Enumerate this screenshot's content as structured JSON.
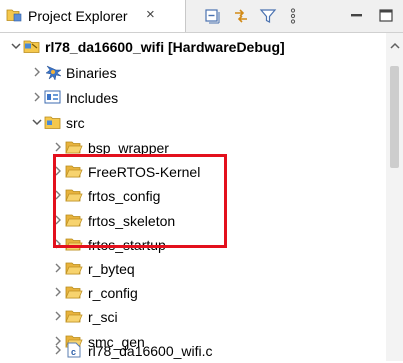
{
  "view": {
    "title": "Project Explorer",
    "close_glyph": "×",
    "toolbar": [
      {
        "name": "collapse-all-icon"
      },
      {
        "name": "link-with-editor-icon"
      },
      {
        "name": "filter-icon"
      },
      {
        "name": "view-menu-icon"
      },
      {
        "name": "minimize-icon"
      },
      {
        "name": "maximize-icon"
      }
    ]
  },
  "tree": {
    "project": {
      "label": "rl78_da16600_wifi [HardwareDebug]",
      "icon": "project-icon"
    },
    "binaries": {
      "label": "Binaries",
      "icon": "binaries-icon"
    },
    "includes": {
      "label": "Includes",
      "icon": "includes-icon"
    },
    "src": {
      "label": "src",
      "icon": "source-folder-icon"
    },
    "folders": [
      {
        "label": "bsp_wrapper"
      },
      {
        "label": "FreeRTOS-Kernel"
      },
      {
        "label": "frtos_config"
      },
      {
        "label": "frtos_skeleton"
      },
      {
        "label": "frtos_startup"
      },
      {
        "label": "r_byteq"
      },
      {
        "label": "r_config"
      },
      {
        "label": "r_sci"
      },
      {
        "label": "smc_gen"
      }
    ],
    "file": {
      "label": "rl78_da16600_wifi.c",
      "icon": "c-file-icon"
    }
  },
  "colors": {
    "highlight": "#e3101d",
    "folder": "#f2c253",
    "chevron": "#7b7b7b"
  }
}
